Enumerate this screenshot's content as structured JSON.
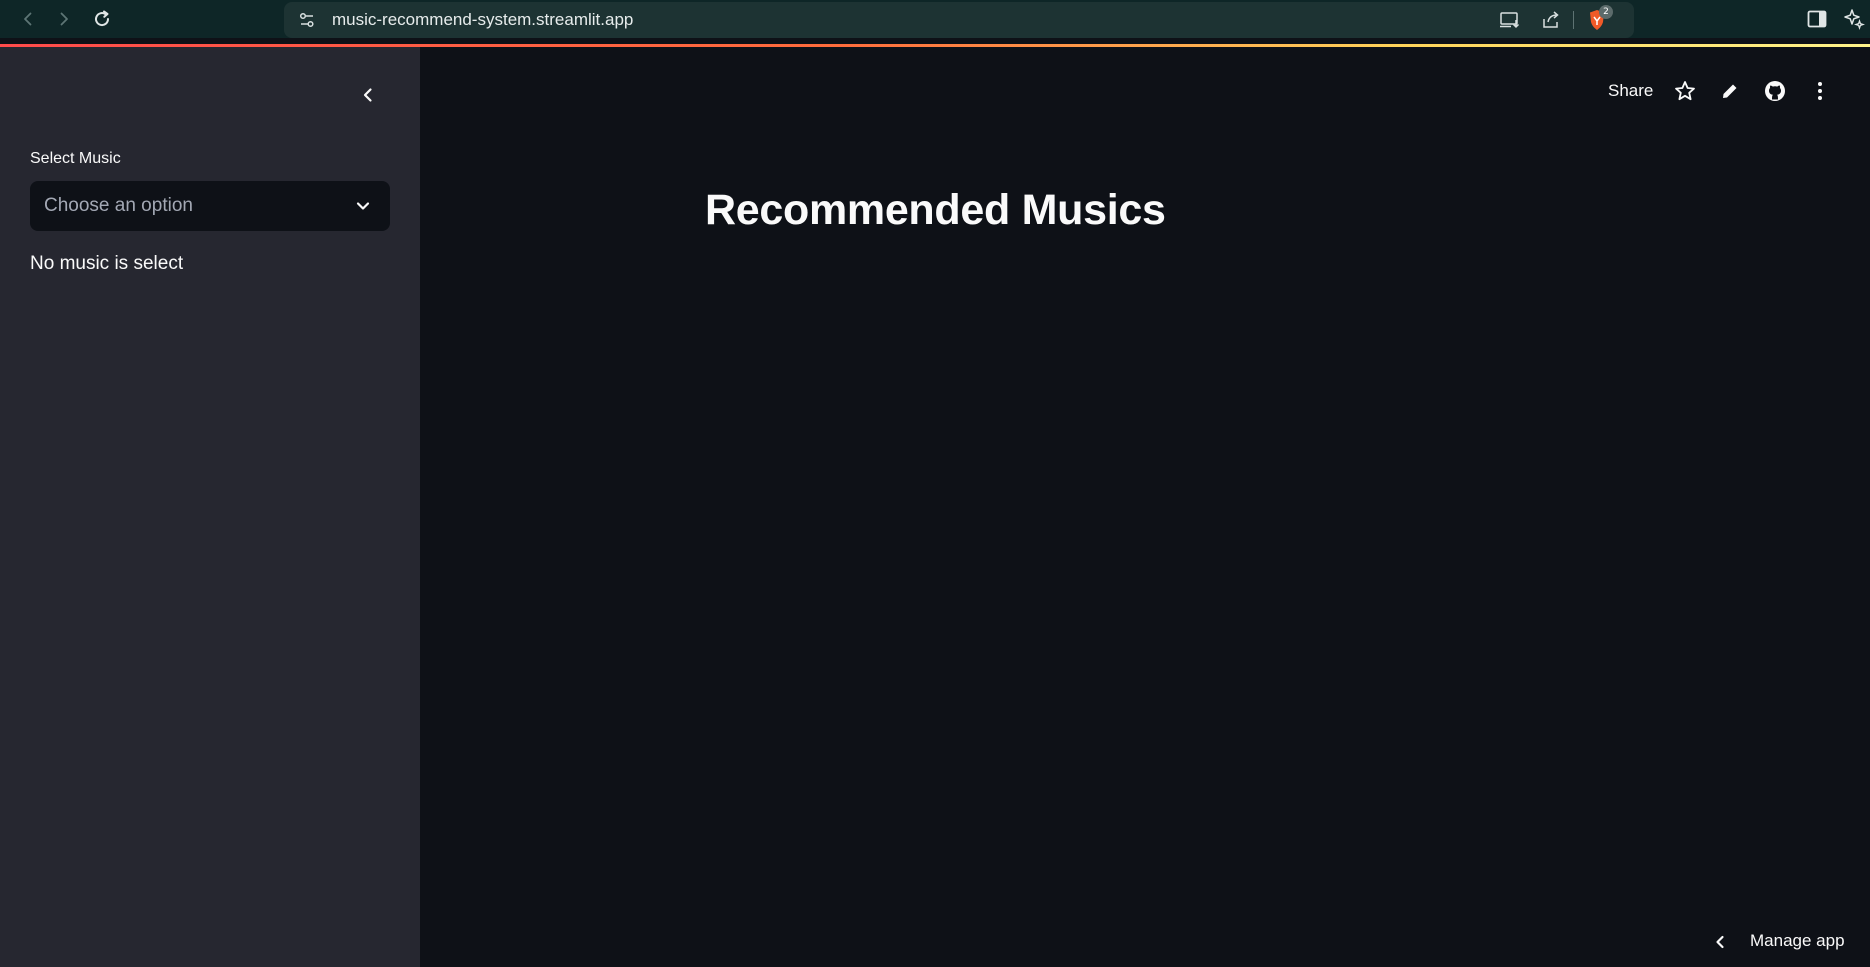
{
  "browser": {
    "url": "music-recommend-system.streamlit.app",
    "extension_badge_count": "2",
    "icons": [
      "back-icon",
      "forward-icon",
      "reload-icon",
      "site-settings-icon",
      "install-app-icon",
      "share-page-icon",
      "brave-shield-icon",
      "sidebar-toggle-icon",
      "ai-sparkle-icon"
    ],
    "stripe_colors": [
      "#ff4b4b",
      "#ffd45a",
      "#fff38a"
    ]
  },
  "sidebar": {
    "select_label": "Select Music",
    "select_placeholder": "Choose an option",
    "status_text": "No music is select"
  },
  "main": {
    "title": "Recommended Musics",
    "toolbar": {
      "share_label": "Share",
      "icons": [
        "star-icon",
        "edit-icon",
        "github-icon",
        "more-vert-icon"
      ]
    },
    "manage_app_label": "Manage app"
  },
  "colors": {
    "sidebar_bg": "#262730",
    "main_bg": "#0e1117",
    "browser_bar_bg": "#0e2627",
    "text": "#fafafa"
  }
}
